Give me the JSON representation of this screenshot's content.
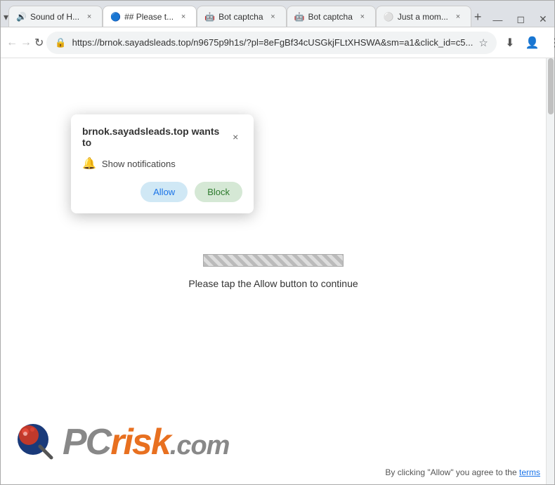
{
  "browser": {
    "tabs": [
      {
        "id": "tab1",
        "title": "Sound of H...",
        "favicon": "🔊",
        "active": false
      },
      {
        "id": "tab2",
        "title": "## Please t...",
        "favicon": "🔵",
        "active": true
      },
      {
        "id": "tab3",
        "title": "Bot captcha",
        "favicon": "🤖",
        "active": false
      },
      {
        "id": "tab4",
        "title": "Bot captcha",
        "favicon": "🤖",
        "active": false
      },
      {
        "id": "tab5",
        "title": "Just a mom...",
        "favicon": "⚪",
        "active": false
      }
    ],
    "address": "https://brnok.sayadsleads.top/n9675p9h1s/?pl=8eFgBf34cUSGkjFLtXHSWA&sm=a1&click_id=c5...",
    "back_label": "←",
    "forward_label": "→",
    "refresh_label": "↻"
  },
  "popup": {
    "title": "brnok.sayadsleads.top wants to",
    "notification_text": "Show notifications",
    "allow_label": "Allow",
    "block_label": "Block",
    "close_label": "×"
  },
  "page": {
    "progress_text": "Please tap the Allow button to continue",
    "terms_text": "By clicking \"Allow\" you agree to the",
    "terms_link": "terms"
  },
  "logo": {
    "pc_text": "PC",
    "risk_text": "risk",
    "com_text": ".com"
  },
  "icons": {
    "bell": "🔔",
    "lock": "🔒",
    "star": "☆",
    "download": "⬇",
    "person": "👤",
    "menu": "⋮",
    "new_tab": "+",
    "tab_dropdown": "▾"
  }
}
